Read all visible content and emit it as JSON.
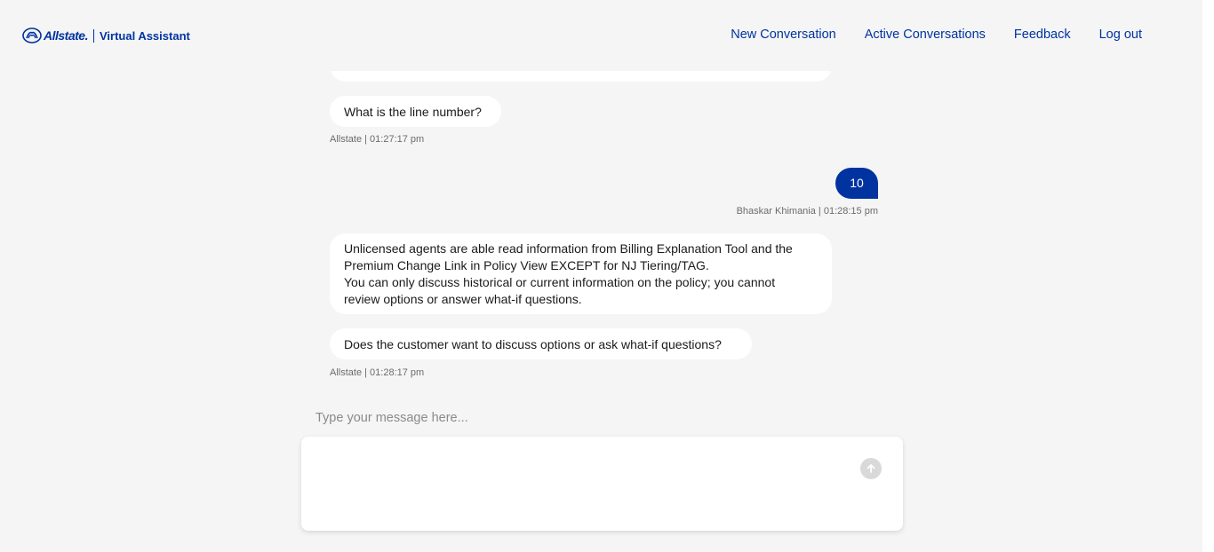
{
  "header": {
    "brand": "Allstate.",
    "product": "Virtual Assistant",
    "nav": [
      {
        "label": "New Conversation"
      },
      {
        "label": "Active Conversations"
      },
      {
        "label": "Feedback"
      },
      {
        "label": "Log out"
      }
    ]
  },
  "messages": [
    {
      "text": "What is the line number?"
    },
    {
      "meta": "Allstate | 01:27:17 pm"
    },
    {
      "text": "10",
      "meta": "Bhaskar Khimania | 01:28:15 pm"
    },
    {
      "line1": "Unlicensed agents are able read information from Billing Explanation Tool and the",
      "line2": "Premium Change Link in Policy View EXCEPT for NJ Tiering/TAG.",
      "line3": "You can only discuss historical or current information on the policy; you cannot",
      "line4": "review options or answer what-if questions."
    },
    {
      "text": "Does the customer want to discuss options or ask what-if questions?",
      "meta": "Allstate | 01:28:17 pm"
    }
  ],
  "composer": {
    "placeholder": "Type your message here...",
    "value": ""
  },
  "colors": {
    "brand_blue": "#0033a0",
    "background": "#f5f5f5",
    "send_button": "#d9d9d9"
  },
  "icons": {
    "logo": "allstate-hands-icon",
    "send": "arrow-up-icon"
  }
}
